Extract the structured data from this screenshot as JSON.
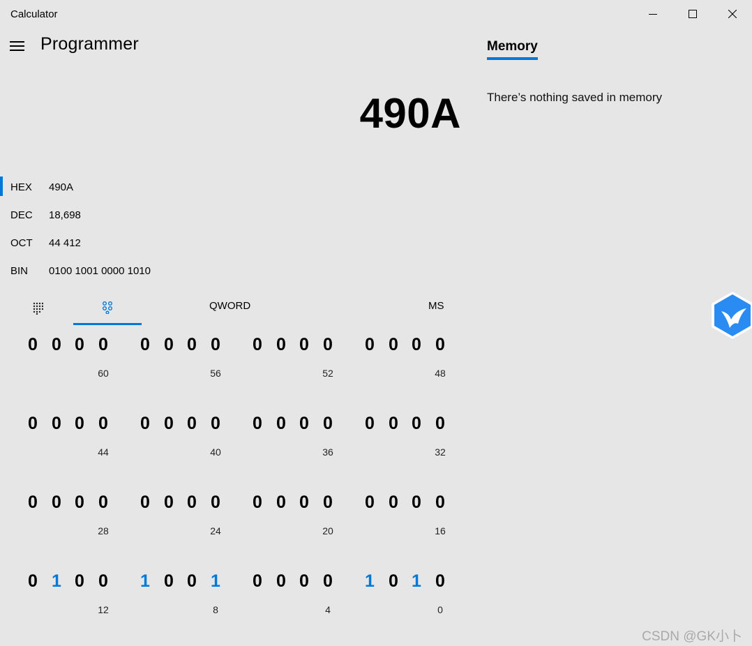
{
  "window": {
    "title": "Calculator",
    "minimize_icon": "minimize-icon",
    "maximize_icon": "maximize-icon",
    "close_icon": "close-icon"
  },
  "header": {
    "menu_icon": "hamburger-icon",
    "mode": "Programmer"
  },
  "display": {
    "value": "490A"
  },
  "radix": [
    {
      "name": "HEX",
      "value": "490A",
      "active": true
    },
    {
      "name": "DEC",
      "value": "18,698",
      "active": false
    },
    {
      "name": "OCT",
      "value": "44 412",
      "active": false
    },
    {
      "name": "BIN",
      "value": "0100 1001 0000 1010",
      "active": false
    }
  ],
  "keypad_tabs": {
    "full_keypad_icon": "full-keypad-icon",
    "bit_toggle_icon": "bit-toggle-keypad-icon",
    "word_size": "QWORD",
    "memory_store": "MS"
  },
  "bit_rows": [
    {
      "labels": [
        "60",
        "56",
        "52",
        "48"
      ],
      "bits": "0000000000000000"
    },
    {
      "labels": [
        "44",
        "40",
        "36",
        "32"
      ],
      "bits": "0000000000000000"
    },
    {
      "labels": [
        "28",
        "24",
        "20",
        "16"
      ],
      "bits": "0000000000000000"
    },
    {
      "labels": [
        "12",
        "8",
        "4",
        "0"
      ],
      "bits": "0100100100001010"
    }
  ],
  "accent_color": "#0078d7",
  "memory": {
    "tab": "Memory",
    "empty_message": "There’s nothing saved in memory"
  },
  "overlay": {
    "floating_icon": "bird-badge-icon"
  },
  "watermark": "CSDN @GK小卜"
}
